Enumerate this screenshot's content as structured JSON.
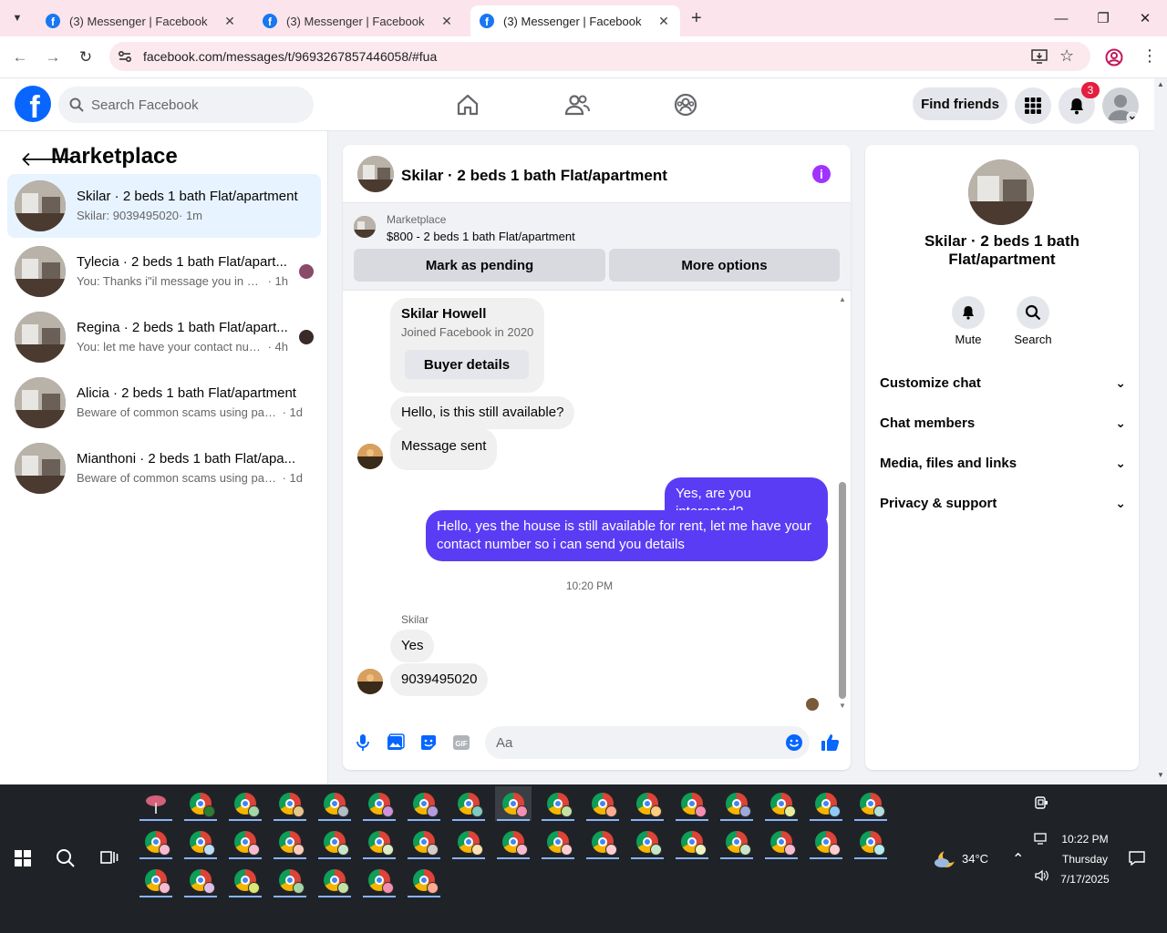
{
  "browser": {
    "tabs": [
      {
        "title": "(3) Messenger | Facebook"
      },
      {
        "title": "(3) Messenger | Facebook"
      },
      {
        "title": "(3) Messenger | Facebook"
      }
    ],
    "url": "facebook.com/messages/t/9693267857446058/#fua"
  },
  "fb": {
    "search_placeholder": "Search Facebook",
    "find_friends": "Find friends",
    "notification_count": "3"
  },
  "marketplace": {
    "title": "Marketplace",
    "conversations": [
      {
        "title": "Skilar · 2 beds 1 bath Flat/apartment",
        "preview": "Skilar: 9039495020",
        "time": "· 1m"
      },
      {
        "title": "Tylecia · 2 beds 1 bath Flat/apart...",
        "preview": "You: Thanks i\"il message you in a ...",
        "time": "· 1h"
      },
      {
        "title": "Regina · 2 beds 1 bath Flat/apart...",
        "preview": "You: let me have your contact num...",
        "time": "· 4h"
      },
      {
        "title": "Alicia · 2 beds 1 bath Flat/apartment",
        "preview": "Beware of common scams using pay...",
        "time": "· 1d"
      },
      {
        "title": "Mianthoni · 2 beds 1 bath Flat/apa...",
        "preview": "Beware of common scams using pay...",
        "time": "· 1d"
      }
    ]
  },
  "chat": {
    "title": "Skilar · 2 beds 1 bath Flat/apartment",
    "info_icon": "info-icon",
    "listing_label": "Marketplace",
    "listing_price": "$800 - 2 beds 1 bath Flat/apartment",
    "mark_pending": "Mark as pending",
    "more_options": "More options",
    "buyer_name": "Skilar Howell",
    "buyer_joined": "Joined Facebook in 2020",
    "buyer_details": "Buyer details",
    "messages": [
      {
        "text": "Hello, is this still available?"
      },
      {
        "text": "Message sent"
      },
      {
        "text": "Yes, are you interested?"
      },
      {
        "text": "Hello, yes the house is still available for rent, let me have your contact number so i can send you details"
      },
      {
        "text": "Yes"
      },
      {
        "text": "9039495020"
      }
    ],
    "timestamp": "10:20 PM",
    "sender_name": "Skilar",
    "input_placeholder": "Aa"
  },
  "details": {
    "title": "Skilar · 2 beds 1 bath Flat/apartment",
    "mute": "Mute",
    "search": "Search",
    "sections": [
      "Customize chat",
      "Chat members",
      "Media, files and links",
      "Privacy & support"
    ]
  },
  "taskbar": {
    "weather": "34°C",
    "time": "10:22 PM",
    "day": "Thursday",
    "date": "7/17/2025"
  },
  "colors": {
    "fb_blue": "#0866ff",
    "outgoing_bubble": "#5b3cf5",
    "tab_strip": "#fce4ec",
    "info_purple": "#a033ff",
    "badge_red": "#e41e3f"
  }
}
